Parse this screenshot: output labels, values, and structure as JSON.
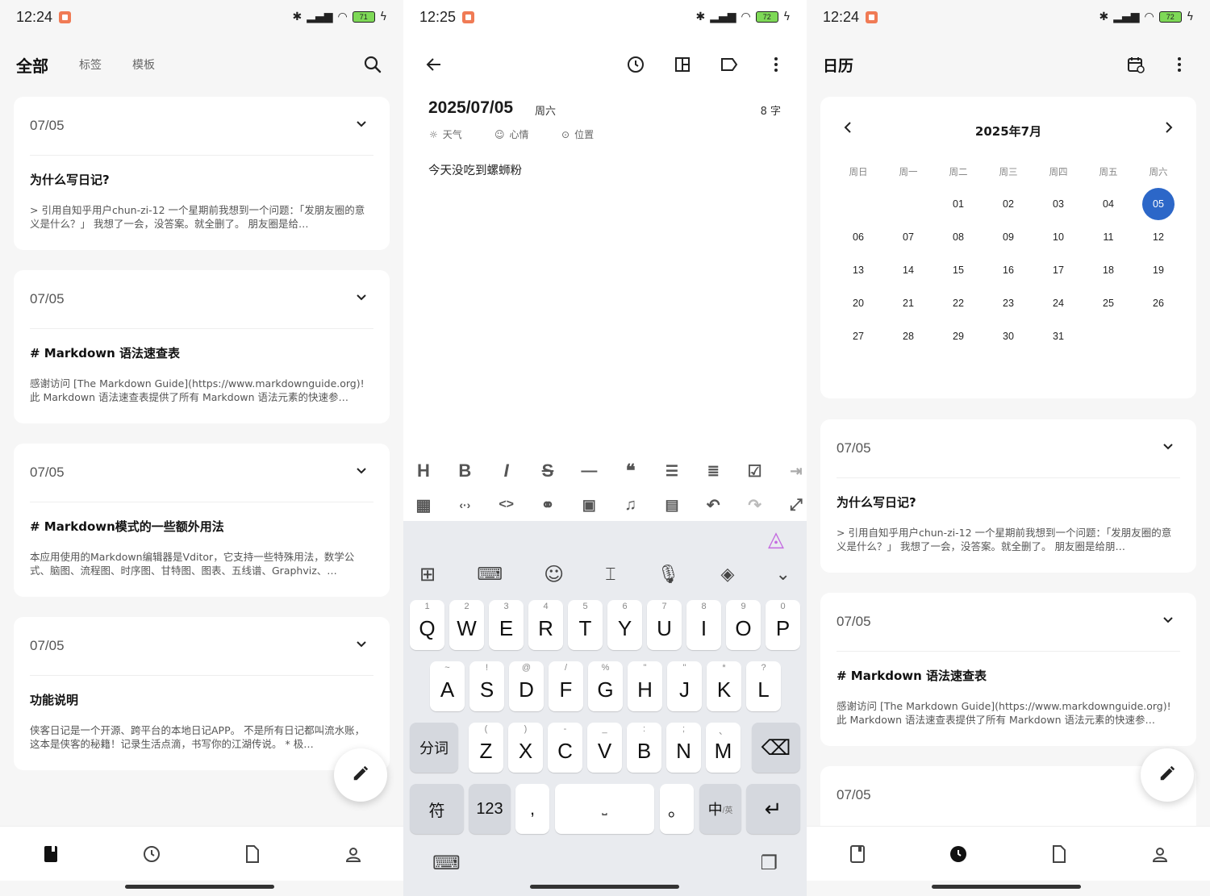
{
  "colors": {
    "accent": "#2c67c8",
    "battery": "#7ed957"
  },
  "left": {
    "status": {
      "time": "12:24",
      "battery": "71"
    },
    "tabs": {
      "active": "全部",
      "tags": "标签",
      "templates": "模板"
    },
    "cards": [
      {
        "date": "07/05",
        "title": "为什么写日记?",
        "excerpt": "> 引用自知乎用户chun-zi-12 一个星期前我想到一个问题：「发朋友圈的意义是什么？」 我想了一会，没答案。就全删了。 朋友圈是给…"
      },
      {
        "date": "07/05",
        "title": "# Markdown 语法速查表",
        "excerpt": "感谢访问 [The Markdown Guide](https://www.markdownguide.org)! 此 Markdown 语法速查表提供了所有 Markdown 语法元素的快速参…"
      },
      {
        "date": "07/05",
        "title": "# Markdown模式的一些额外用法",
        "excerpt": "本应用使用的Markdown编辑器是Vditor，它支持一些特殊用法，数学公式、脑图、流程图、时序图、甘特图、图表、五线谱、Graphviz、…"
      },
      {
        "date": "07/05",
        "title": "功能说明",
        "excerpt": "侠客日记是一个开源、跨平台的本地日记APP。 不是所有日记都叫流水账，这本是侠客的秘籍！记录生活点滴，书写你的江湖传说。 * 极…"
      }
    ]
  },
  "mid": {
    "status": {
      "time": "12:25",
      "battery": "72"
    },
    "entry": {
      "date": "2025/07/05",
      "weekday": "周六",
      "count": "8 字",
      "weather": "天气",
      "mood": "心情",
      "location": "位置",
      "body": "今天没吃到螺蛳粉"
    },
    "keyboard": {
      "row1": [
        {
          "k": "Q",
          "s": "1"
        },
        {
          "k": "W",
          "s": "2"
        },
        {
          "k": "E",
          "s": "3"
        },
        {
          "k": "R",
          "s": "4"
        },
        {
          "k": "T",
          "s": "5"
        },
        {
          "k": "Y",
          "s": "6"
        },
        {
          "k": "U",
          "s": "7"
        },
        {
          "k": "I",
          "s": "8"
        },
        {
          "k": "O",
          "s": "9"
        },
        {
          "k": "P",
          "s": "0"
        }
      ],
      "row2": [
        {
          "k": "A",
          "s": "~"
        },
        {
          "k": "S",
          "s": "!"
        },
        {
          "k": "D",
          "s": "@"
        },
        {
          "k": "F",
          "s": "/"
        },
        {
          "k": "G",
          "s": "%"
        },
        {
          "k": "H",
          "s": "\""
        },
        {
          "k": "J",
          "s": "\""
        },
        {
          "k": "K",
          "s": "*"
        },
        {
          "k": "L",
          "s": "?"
        }
      ],
      "row3": [
        {
          "k": "Z",
          "s": "("
        },
        {
          "k": "X",
          "s": ")"
        },
        {
          "k": "C",
          "s": "-"
        },
        {
          "k": "V",
          "s": "_"
        },
        {
          "k": "B",
          "s": ":"
        },
        {
          "k": "N",
          "s": ";"
        },
        {
          "k": "M",
          "s": "、"
        }
      ],
      "segment": "分词",
      "symbols": "符",
      "numbers": "123",
      "comma": ",",
      "period": "。",
      "lang": "中",
      "lang_sub": "/英"
    }
  },
  "right": {
    "status": {
      "time": "12:24",
      "battery": "72"
    },
    "title": "日历",
    "calendar": {
      "month": "2025年7月",
      "weekdays": [
        "周日",
        "周一",
        "周二",
        "周三",
        "周四",
        "周五",
        "周六"
      ],
      "days": [
        "",
        "",
        "01",
        "02",
        "03",
        "04",
        "05",
        "06",
        "07",
        "08",
        "09",
        "10",
        "11",
        "12",
        "13",
        "14",
        "15",
        "16",
        "17",
        "18",
        "19",
        "20",
        "21",
        "22",
        "23",
        "24",
        "25",
        "26",
        "27",
        "28",
        "29",
        "30",
        "31"
      ],
      "selected": "05"
    },
    "cards": [
      {
        "date": "07/05",
        "title": "为什么写日记?",
        "excerpt": "> 引用自知乎用户chun-zi-12 一个星期前我想到一个问题：「发朋友圈的意义是什么？」 我想了一会，没答案。就全删了。 朋友圈是给朋…"
      },
      {
        "date": "07/05",
        "title": "# Markdown 语法速查表",
        "excerpt": "感谢访问 [The Markdown Guide](https://www.markdownguide.org)! 此 Markdown 语法速查表提供了所有 Markdown 语法元素的快速参…"
      },
      {
        "date": "07/05"
      }
    ]
  }
}
